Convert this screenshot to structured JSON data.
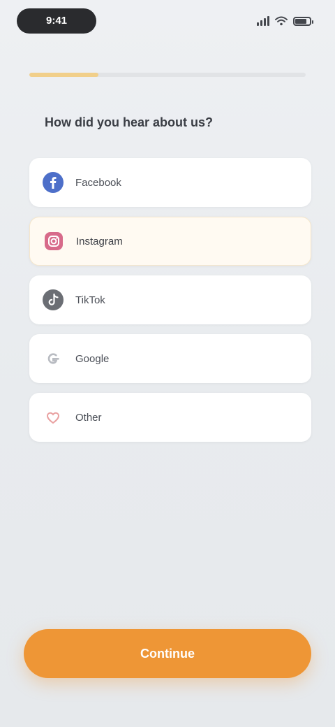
{
  "status_bar": {
    "time": "9:41"
  },
  "progress": {
    "fraction": 0.25,
    "color": "#f1cf8a"
  },
  "question": "How did you hear about us?",
  "options": [
    {
      "label": "Facebook",
      "icon": "facebook-icon",
      "color": "#4d6fc9",
      "selected": false
    },
    {
      "label": "Instagram",
      "icon": "instagram-icon",
      "color": "#d76a8a",
      "selected": true
    },
    {
      "label": "TikTok",
      "icon": "tiktok-icon",
      "color": "#6b6e74",
      "selected": false
    },
    {
      "label": "Google",
      "icon": "google-icon",
      "color": "#c9ccd0",
      "selected": false
    },
    {
      "label": "Other",
      "icon": "heart-icon",
      "color": "#e9a1a1",
      "selected": false
    }
  ],
  "cta": {
    "label": "Continue",
    "color": "#ee9636"
  }
}
